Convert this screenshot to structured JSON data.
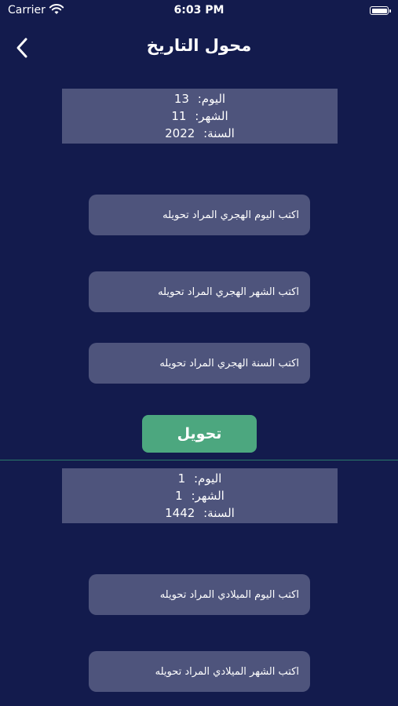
{
  "status_bar": {
    "carrier": "Carrier",
    "time": "6:03 PM"
  },
  "nav": {
    "title": "محول التاريخ",
    "back_icon": "chevron-left-icon"
  },
  "gregorian_result": {
    "day_label": "اليوم:",
    "day_value": "13",
    "month_label": "الشهر:",
    "month_value": "11",
    "year_label": "السنة:",
    "year_value": "2022"
  },
  "hijri_inputs": {
    "day_placeholder": "اكتب اليوم الهجري المراد تحويله",
    "month_placeholder": "اكتب الشهر الهجري المراد تحويله",
    "year_placeholder": "اكتب السنة الهجري المراد تحويله"
  },
  "convert_button_label": "تحويل",
  "hijri_result": {
    "day_label": "اليوم:",
    "day_value": "1",
    "month_label": "الشهر:",
    "month_value": "1",
    "year_label": "السنة:",
    "year_value": "1442"
  },
  "gregorian_inputs": {
    "day_placeholder": "اكتب اليوم الميلادي المراد تحويله",
    "month_placeholder": "اكتب الشهر الميلادي المراد تحويله"
  },
  "colors": {
    "background": "#131b4d",
    "field": "#4e547c",
    "accent": "#4ca77f",
    "text": "#ffffff"
  }
}
